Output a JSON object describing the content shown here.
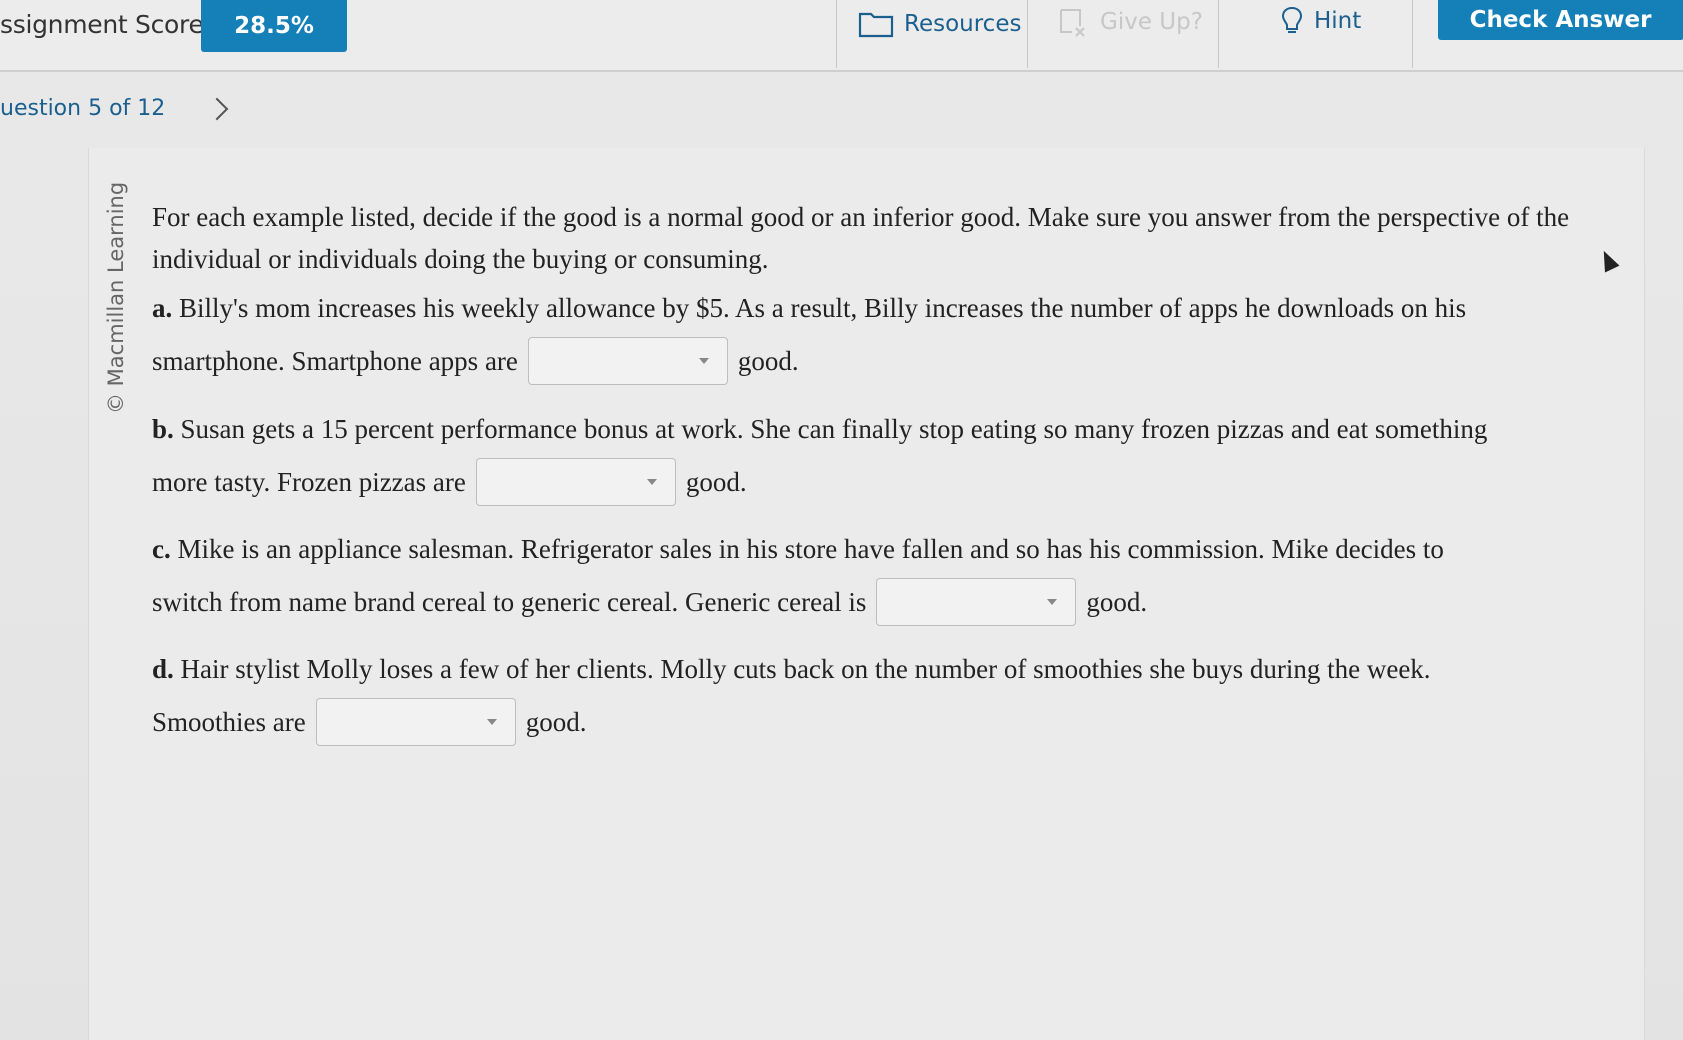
{
  "toolbar": {
    "score_label": "ssignment Score:",
    "score_value": "28.5%",
    "resources_label": "Resources",
    "giveup_label": "Give Up?",
    "hint_label": "Hint",
    "check_label": "Check Answer"
  },
  "nav": {
    "question_label": "uestion 5 of 12"
  },
  "copyright": "© Macmillan Learning",
  "question": {
    "intro": "For each example listed, decide if the good is a normal good or an inferior good. Make sure you answer from the perspective of the individual or individuals doing the buying or consuming.",
    "parts": [
      {
        "letter": "a.",
        "text": "Billy's mom increases his weekly allowance by $5. As a result, Billy increases the number of apps he downloads on his",
        "lead": "smartphone. Smartphone apps are",
        "selected": "",
        "tail": "good."
      },
      {
        "letter": "b.",
        "text": "Susan gets a 15 percent performance bonus at work. She can finally stop eating so many frozen pizzas and eat something",
        "lead": "more tasty. Frozen pizzas are",
        "selected": "",
        "tail": "good."
      },
      {
        "letter": "c.",
        "text": "Mike is an appliance salesman. Refrigerator sales in his store have fallen and so has his commission. Mike decides to",
        "lead": "switch from name brand cereal to generic cereal. Generic cereal is",
        "selected": "",
        "tail": "good."
      },
      {
        "letter": "d.",
        "text": "Hair stylist Molly loses a few of her clients. Molly cuts back on the number of smoothies she buys during the week.",
        "lead": "Smoothies are",
        "selected": "",
        "tail": "good."
      }
    ]
  }
}
